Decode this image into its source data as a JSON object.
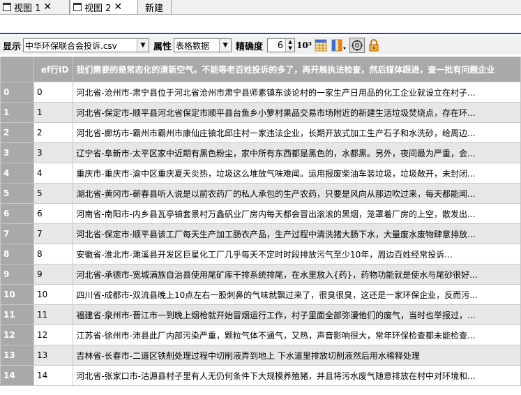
{
  "tabs": [
    {
      "label": "视图 1",
      "active": false
    },
    {
      "label": "视图 2",
      "active": true
    },
    {
      "label": "新建",
      "active": false
    }
  ],
  "toolbar": {
    "display_label": "显示",
    "display_value": "中华环保联合会投诉.csv",
    "attr_label": "属性",
    "attr_value": "表格数据",
    "precision_label": "精确度",
    "precision_value": "6",
    "sci_label": "10³"
  },
  "table": {
    "headers": [
      "ef行ID",
      "我们需要的是常态化的清新空气。不能等老百姓投诉的多了，再开展执法检查，然后媒体跟进，查一批有问题企业"
    ],
    "rows": [
      {
        "n": "0",
        "id": "0",
        "text": "河北省-沧州市-肃宁县位于河北省沧州市肃宁县师素镇东谈论村的一家生产日用品的化工企业就设立在村子..."
      },
      {
        "n": "1",
        "id": "1",
        "text": "河北省-保定市-顺平县河北省保定市顺平县台鱼乡小箩村果品交易市场附近的新建生活垃圾焚烧点，存在环..."
      },
      {
        "n": "2",
        "id": "2",
        "text": "河北省-廊坊市-霸州市霸州市康仙庄镇北邱庄村一家违法企业，长期开放式加工生产石子和水洗砂，给周边..."
      },
      {
        "n": "3",
        "id": "3",
        "text": "辽宁省-阜新市-太平区家中近期有黑色粉尘，家中所有东西都是黑色的，水都黑。另外，夜间最为严重，会..."
      },
      {
        "n": "4",
        "id": "4",
        "text": "重庆市-重庆市-渝中区重庆夏天炎热，垃圾这么堆放气味难闻。运用报废柴油车装垃圾，垃圾敞开，未封闭..."
      },
      {
        "n": "5",
        "id": "5",
        "text": "湖北省-黄冈市-蕲春县听人说是以前农药厂的私人承包的生产农药，只要是风向从那边吹过来，每天都能闻..."
      },
      {
        "n": "6",
        "id": "6",
        "text": "河南省-南阳市-内乡县瓦亭镇套景村万鑫矾业厂房内每天都会冒出滚滚的黑烟，笼罩着厂房的上空，散发出..."
      },
      {
        "n": "7",
        "id": "7",
        "text": "河北省-保定市-顺平县该工厂每天生产加工肠衣产品，生产过程中清洗猪大肠下水，大量废水废物肆意排放..."
      },
      {
        "n": "8",
        "id": "8",
        "text": "安徽省-淮北市-濉溪县开发区巨星化工厂几乎每天不定时时段排放污气至少10年，周边百姓经常投诉..."
      },
      {
        "n": "9",
        "id": "9",
        "text": "河北省-承德市-宽城满族自治县使用尾矿库干排系统排尾，在水里放入{药}，药物功能就是使水与尾砂很好..."
      },
      {
        "n": "10",
        "id": "10",
        "text": "四川省-成都市-双流县晚上10点左右一股刺鼻的气味就飘过来了，很臭很臭，这还是一家环保企业，反而污..."
      },
      {
        "n": "11",
        "id": "11",
        "text": "福建省-泉州市-晋江市一到晚上烟枪就开始冒烟运行工作，村子里面全部弥漫他们的废气，当时也举报过，..."
      },
      {
        "n": "12",
        "id": "12",
        "text": "江苏省-徐州市-沛县此厂内部污染严重，颗粒气体不通气，又热，声音影响很大，常年环保检查都未能检查..."
      },
      {
        "n": "13",
        "id": "13",
        "text": "吉林省-长春市-二道区铁削处理过程中切削液弄到地上  下水道里排放切削液然后用水稀释处理"
      },
      {
        "n": "14",
        "id": "14",
        "text": "河北省-张家口市-沽源县村子里有人无仍何条件下大规模养殖猪，并且将污水废气随意排放在村中对环境和..."
      }
    ]
  }
}
